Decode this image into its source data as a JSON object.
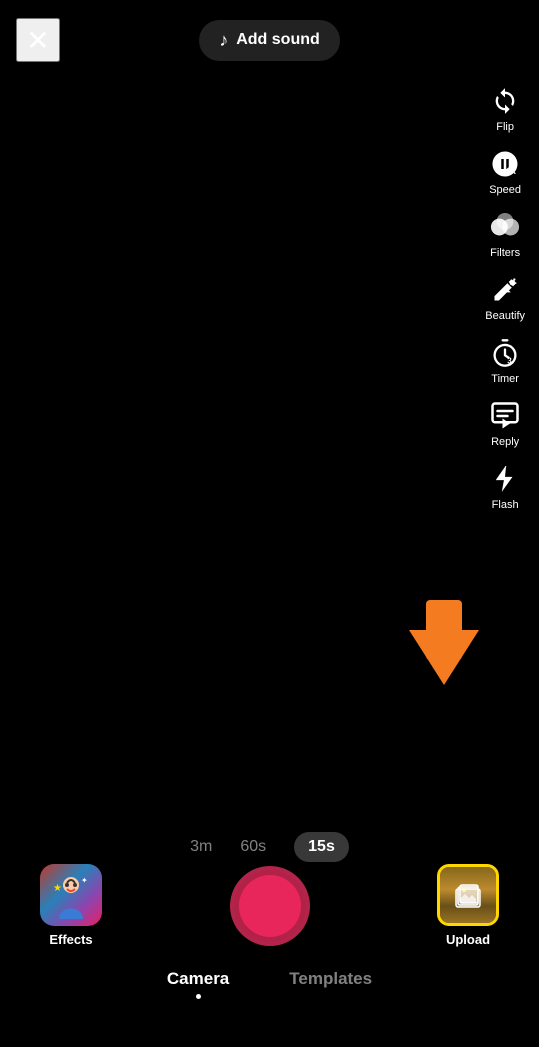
{
  "topBar": {
    "closeLabel": "✕",
    "addSound": {
      "icon": "♪",
      "label": "Add sound"
    }
  },
  "toolbar": {
    "items": [
      {
        "id": "flip",
        "label": "Flip"
      },
      {
        "id": "speed",
        "label": "Speed"
      },
      {
        "id": "filters",
        "label": "Filters"
      },
      {
        "id": "beautify",
        "label": "Beautify"
      },
      {
        "id": "timer",
        "label": "Timer"
      },
      {
        "id": "reply",
        "label": "Reply"
      },
      {
        "id": "flash",
        "label": "Flash"
      }
    ]
  },
  "durationBar": {
    "options": [
      "3m",
      "60s",
      "15s"
    ],
    "active": "15s"
  },
  "bottomActions": {
    "effects": {
      "label": "Effects"
    },
    "upload": {
      "label": "Upload"
    }
  },
  "bottomNav": {
    "items": [
      {
        "id": "camera",
        "label": "Camera",
        "active": true
      },
      {
        "id": "templates",
        "label": "Templates",
        "active": false
      }
    ]
  },
  "colors": {
    "accent": "#E8265C",
    "arrowColor": "#F47B20",
    "highlightBorder": "#FFD700"
  }
}
